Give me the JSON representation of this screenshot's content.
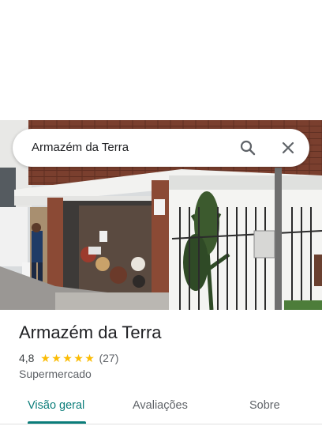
{
  "search": {
    "query": "Armazém da Terra"
  },
  "place": {
    "name": "Armazém da Terra",
    "rating": "4,8",
    "stars": 5,
    "review_count": "(27)",
    "category": "Supermercado"
  },
  "tabs": [
    {
      "label": "Visão geral",
      "active": true
    },
    {
      "label": "Avaliações",
      "active": false
    },
    {
      "label": "Sobre",
      "active": false
    }
  ],
  "colors": {
    "accent": "#0b7d7a",
    "star": "#fbbc04"
  }
}
